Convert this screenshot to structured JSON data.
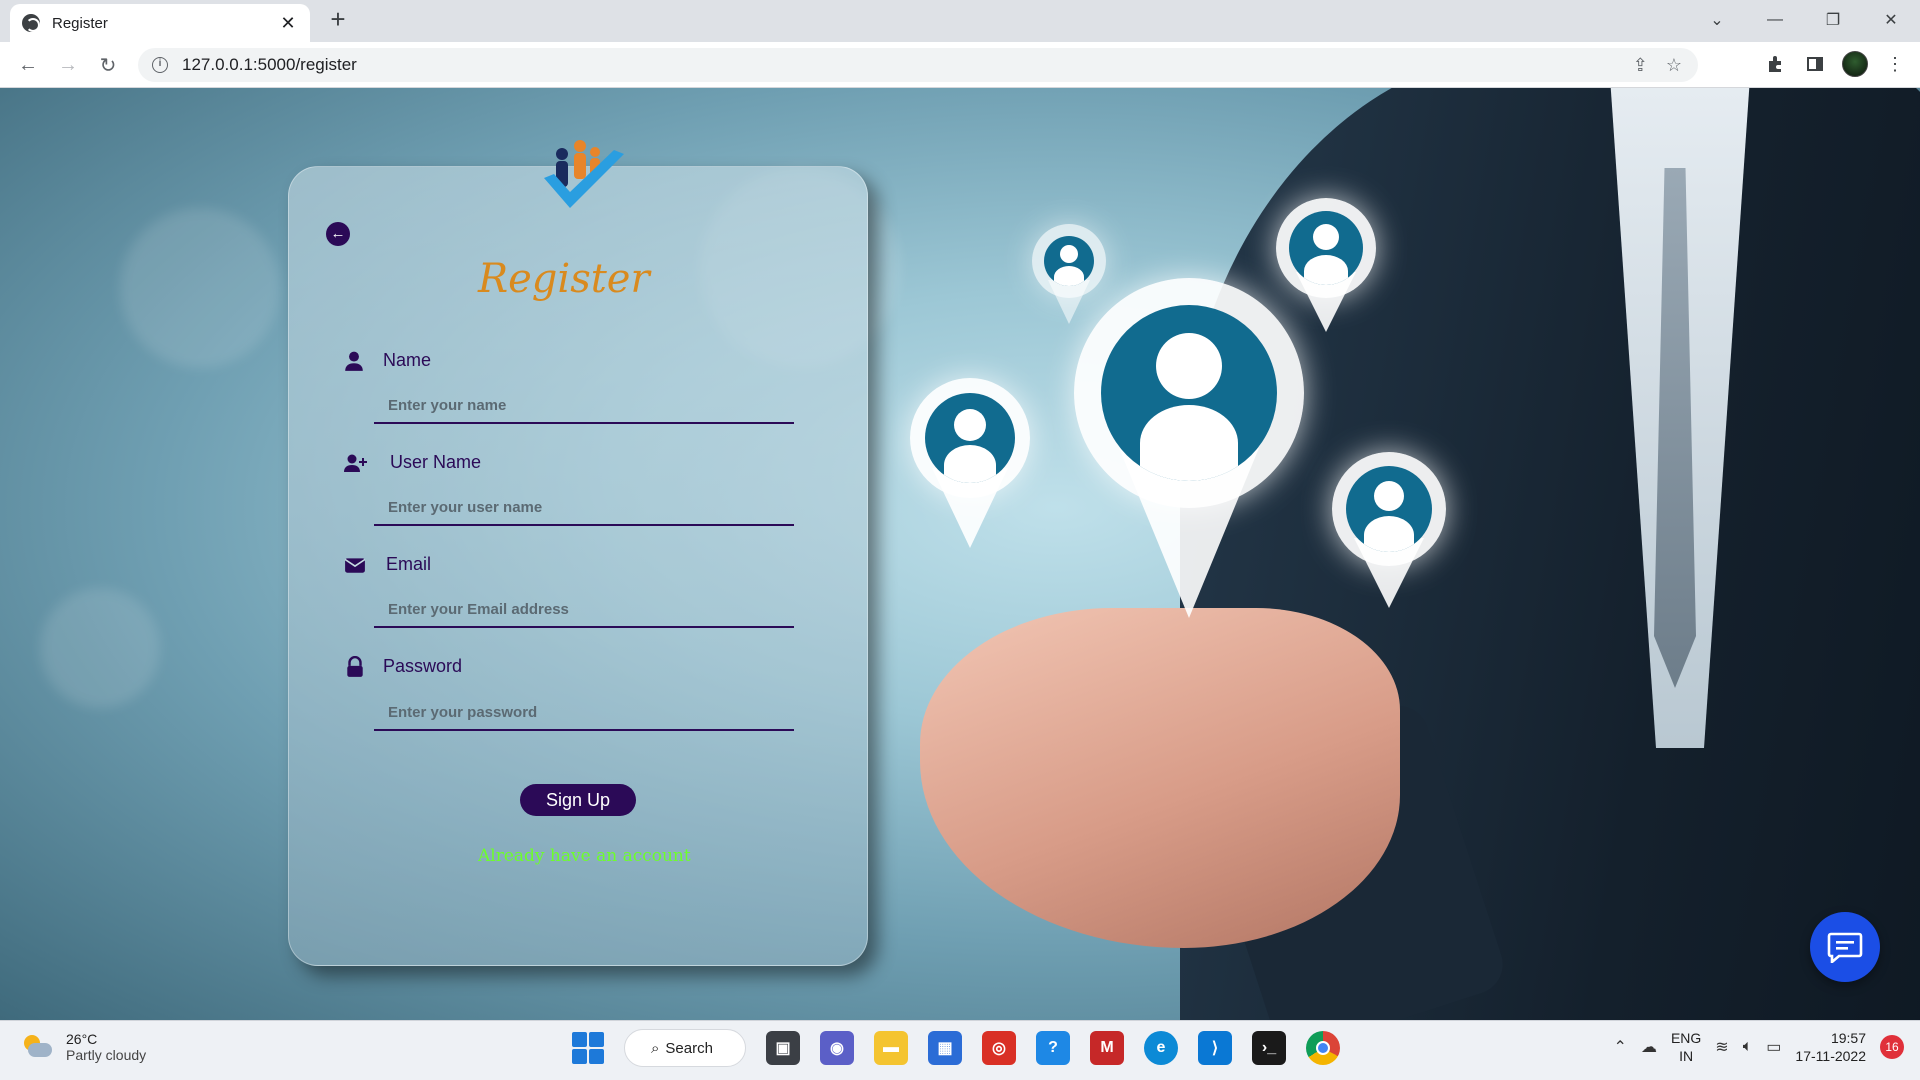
{
  "browser": {
    "tab_title": "Register",
    "tab_close": "✕",
    "new_tab": "+",
    "url": "127.0.0.1:5000/register",
    "window_controls": [
      "⌄",
      "—",
      "❐",
      "✕"
    ]
  },
  "form": {
    "title": "Register",
    "fields": [
      {
        "label": "Name",
        "placeholder": "Enter your name",
        "icon": "user-icon"
      },
      {
        "label": "User Name",
        "placeholder": "Enter your user name",
        "icon": "user-plus-icon"
      },
      {
        "label": "Email",
        "placeholder": "Enter your Email address",
        "icon": "envelope-icon"
      },
      {
        "label": "Password",
        "placeholder": "Enter your password",
        "icon": "lock-icon"
      }
    ],
    "submit_label": "Sign Up",
    "login_link": "Already have an account"
  },
  "taskbar": {
    "temperature": "26°C",
    "weather": "Partly cloudy",
    "search_label": "Search",
    "language": "ENG",
    "region": "IN",
    "time": "19:57",
    "date": "17-11-2022",
    "notifications": "16"
  },
  "colors": {
    "accent": "#2b0a57",
    "title": "#d98a1e",
    "link": "#6dff2a",
    "pin": "#116b8f"
  }
}
